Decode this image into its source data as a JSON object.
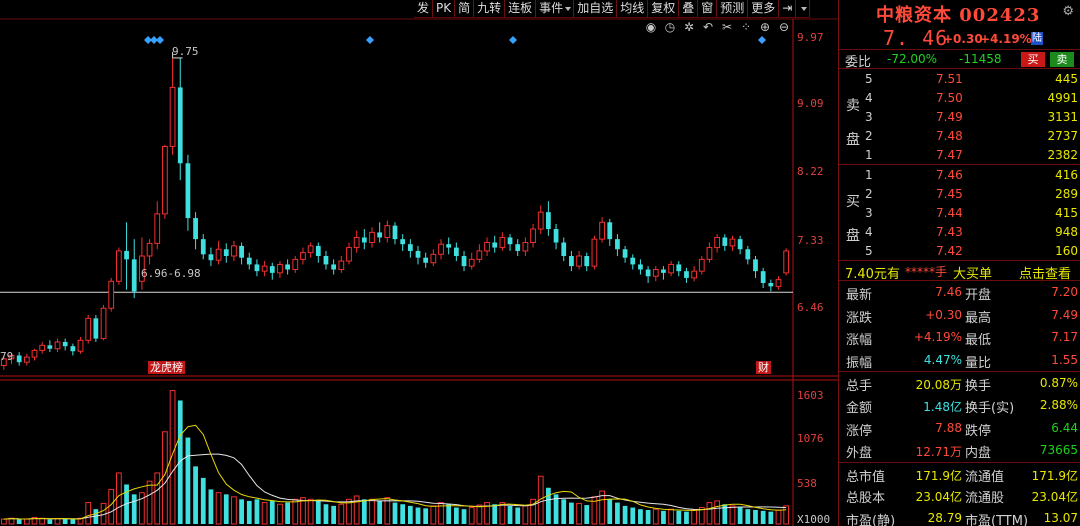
{
  "toolbar": {
    "items": [
      "发",
      "PK",
      "简",
      "九转",
      "连板",
      "事件",
      "加自选",
      "均线",
      "复权",
      "叠",
      "窗",
      "预测",
      "更多"
    ]
  },
  "icons": [
    "eye-icon",
    "clock-icon",
    "settings-icon",
    "undo-icon",
    "scissors-icon",
    "grid-icon",
    "zoom-in-icon",
    "zoom-out-icon"
  ],
  "chart_annotations": {
    "high_label": "9.75",
    "low_label": "6.96-6.98",
    "left_edge_label": "79",
    "event_tag_left": "龙虎榜",
    "event_tag_right": "财"
  },
  "chart_data": {
    "type": "candlestick",
    "price_axis_ticks": [
      "9.97",
      "9.09",
      "8.22",
      "7.33",
      "6.46"
    ],
    "volume_axis_ticks": [
      "1603",
      "1076",
      "538"
    ],
    "volume_unit_label": "X1000",
    "price_range": [
      6.0,
      10.2
    ],
    "reference_line": 6.97,
    "candles": [
      [
        6.1,
        6.18,
        6.05,
        6.2
      ],
      [
        6.18,
        6.22,
        6.12,
        6.25
      ],
      [
        6.22,
        6.14,
        6.1,
        6.26
      ],
      [
        6.14,
        6.2,
        6.1,
        6.24
      ],
      [
        6.2,
        6.28,
        6.16,
        6.3
      ],
      [
        6.28,
        6.34,
        6.24,
        6.38
      ],
      [
        6.34,
        6.3,
        6.26,
        6.4
      ],
      [
        6.3,
        6.38,
        6.26,
        6.42
      ],
      [
        6.38,
        6.33,
        6.28,
        6.42
      ],
      [
        6.33,
        6.27,
        6.22,
        6.36
      ],
      [
        6.27,
        6.4,
        6.24,
        6.44
      ],
      [
        6.4,
        6.66,
        6.36,
        6.7
      ],
      [
        6.66,
        6.42,
        6.38,
        6.7
      ],
      [
        6.42,
        6.78,
        6.4,
        6.82
      ],
      [
        6.78,
        7.1,
        6.74,
        7.14
      ],
      [
        7.1,
        7.46,
        7.06,
        7.5
      ],
      [
        7.46,
        7.36,
        7.0,
        7.8
      ],
      [
        7.36,
        6.98,
        6.9,
        7.6
      ],
      [
        7.1,
        7.4,
        7.0,
        7.62
      ],
      [
        7.4,
        7.55,
        7.3,
        7.6
      ],
      [
        7.55,
        7.9,
        7.48,
        8.05
      ],
      [
        7.9,
        8.7,
        7.84,
        8.72
      ],
      [
        8.7,
        9.4,
        8.6,
        9.75
      ],
      [
        9.4,
        8.5,
        8.3,
        9.75
      ],
      [
        8.5,
        7.85,
        7.7,
        8.6
      ],
      [
        7.85,
        7.6,
        7.48,
        7.92
      ],
      [
        7.6,
        7.42,
        7.36,
        7.66
      ],
      [
        7.42,
        7.35,
        7.28,
        7.5
      ],
      [
        7.35,
        7.48,
        7.3,
        7.58
      ],
      [
        7.48,
        7.4,
        7.32,
        7.55
      ],
      [
        7.4,
        7.52,
        7.34,
        7.58
      ],
      [
        7.52,
        7.38,
        7.3,
        7.56
      ],
      [
        7.38,
        7.3,
        7.24,
        7.44
      ],
      [
        7.3,
        7.22,
        7.16,
        7.36
      ],
      [
        7.22,
        7.28,
        7.16,
        7.34
      ],
      [
        7.28,
        7.2,
        7.12,
        7.32
      ],
      [
        7.2,
        7.3,
        7.14,
        7.34
      ],
      [
        7.3,
        7.24,
        7.18,
        7.36
      ],
      [
        7.24,
        7.36,
        7.2,
        7.4
      ],
      [
        7.36,
        7.44,
        7.3,
        7.5
      ],
      [
        7.44,
        7.52,
        7.38,
        7.56
      ],
      [
        7.52,
        7.4,
        7.32,
        7.56
      ],
      [
        7.4,
        7.3,
        7.24,
        7.46
      ],
      [
        7.3,
        7.24,
        7.18,
        7.36
      ],
      [
        7.24,
        7.34,
        7.2,
        7.4
      ],
      [
        7.34,
        7.5,
        7.3,
        7.56
      ],
      [
        7.5,
        7.62,
        7.44,
        7.7
      ],
      [
        7.62,
        7.56,
        7.48,
        7.72
      ],
      [
        7.56,
        7.68,
        7.5,
        7.74
      ],
      [
        7.68,
        7.62,
        7.56,
        7.8
      ],
      [
        7.62,
        7.76,
        7.56,
        7.82
      ],
      [
        7.76,
        7.6,
        7.54,
        7.8
      ],
      [
        7.6,
        7.54,
        7.46,
        7.66
      ],
      [
        7.54,
        7.46,
        7.38,
        7.6
      ],
      [
        7.46,
        7.38,
        7.3,
        7.52
      ],
      [
        7.38,
        7.32,
        7.26,
        7.44
      ],
      [
        7.32,
        7.42,
        7.28,
        7.48
      ],
      [
        7.42,
        7.54,
        7.36,
        7.6
      ],
      [
        7.54,
        7.5,
        7.42,
        7.62
      ],
      [
        7.5,
        7.4,
        7.34,
        7.56
      ],
      [
        7.4,
        7.28,
        7.22,
        7.46
      ],
      [
        7.28,
        7.36,
        7.24,
        7.44
      ],
      [
        7.36,
        7.46,
        7.32,
        7.54
      ],
      [
        7.46,
        7.56,
        7.4,
        7.62
      ],
      [
        7.56,
        7.5,
        7.44,
        7.64
      ],
      [
        7.5,
        7.62,
        7.46,
        7.68
      ],
      [
        7.62,
        7.54,
        7.46,
        7.66
      ],
      [
        7.54,
        7.46,
        7.4,
        7.6
      ],
      [
        7.46,
        7.56,
        7.4,
        7.62
      ],
      [
        7.56,
        7.72,
        7.5,
        7.78
      ],
      [
        7.72,
        7.92,
        7.66,
        8.0
      ],
      [
        7.92,
        7.72,
        7.64,
        8.05
      ],
      [
        7.72,
        7.56,
        7.48,
        7.78
      ],
      [
        7.56,
        7.4,
        7.34,
        7.62
      ],
      [
        7.4,
        7.28,
        7.22,
        7.46
      ],
      [
        7.28,
        7.4,
        7.24,
        7.46
      ],
      [
        7.4,
        7.28,
        7.22,
        7.44
      ],
      [
        7.28,
        7.6,
        7.24,
        7.64
      ],
      [
        7.6,
        7.8,
        7.56,
        7.86
      ],
      [
        7.8,
        7.6,
        7.52,
        7.84
      ],
      [
        7.6,
        7.48,
        7.4,
        7.66
      ],
      [
        7.48,
        7.38,
        7.32,
        7.52
      ],
      [
        7.38,
        7.3,
        7.24,
        7.42
      ],
      [
        7.3,
        7.24,
        7.18,
        7.36
      ],
      [
        7.24,
        7.16,
        7.08,
        7.28
      ],
      [
        7.16,
        7.24,
        7.1,
        7.28
      ],
      [
        7.24,
        7.2,
        7.12,
        7.28
      ],
      [
        7.2,
        7.3,
        7.16,
        7.34
      ],
      [
        7.3,
        7.22,
        7.16,
        7.34
      ],
      [
        7.22,
        7.14,
        7.08,
        7.26
      ],
      [
        7.14,
        7.22,
        7.1,
        7.28
      ],
      [
        7.22,
        7.36,
        7.18,
        7.4
      ],
      [
        7.36,
        7.5,
        7.32,
        7.56
      ],
      [
        7.5,
        7.62,
        7.44,
        7.66
      ],
      [
        7.62,
        7.52,
        7.46,
        7.66
      ],
      [
        7.52,
        7.6,
        7.46,
        7.64
      ],
      [
        7.6,
        7.48,
        7.42,
        7.64
      ],
      [
        7.48,
        7.36,
        7.3,
        7.52
      ],
      [
        7.36,
        7.22,
        7.14,
        7.4
      ],
      [
        7.22,
        7.08,
        7.02,
        7.26
      ],
      [
        7.08,
        7.04,
        6.98,
        7.12
      ],
      [
        7.04,
        7.12,
        7.0,
        7.16
      ],
      [
        7.2,
        7.46,
        7.17,
        7.49
      ]
    ],
    "volumes": [
      60,
      70,
      55,
      60,
      80,
      70,
      55,
      65,
      60,
      55,
      70,
      260,
      180,
      250,
      420,
      620,
      480,
      360,
      380,
      520,
      620,
      1120,
      1620,
      1500,
      1050,
      700,
      560,
      420,
      380,
      360,
      330,
      300,
      280,
      300,
      260,
      280,
      240,
      260,
      300,
      320,
      300,
      280,
      240,
      220,
      240,
      300,
      340,
      300,
      300,
      280,
      320,
      260,
      240,
      220,
      200,
      190,
      220,
      260,
      240,
      200,
      180,
      200,
      230,
      260,
      240,
      260,
      220,
      200,
      220,
      300,
      580,
      440,
      360,
      300,
      260,
      250,
      230,
      330,
      400,
      300,
      260,
      220,
      200,
      180,
      170,
      180,
      160,
      180,
      160,
      150,
      170,
      200,
      260,
      280,
      240,
      220,
      200,
      180,
      170,
      160,
      150,
      170,
      220
    ]
  },
  "quote": {
    "title": "中粮资本 002423",
    "last_price": "7. 46",
    "change": "+0.30",
    "change_pct": "+4.19%",
    "market_badge": "陆",
    "weibi_label": "委比",
    "weibi_pct": "-72.00%",
    "weibi_diff": "-11458",
    "buy_button": "买",
    "sell_button": "卖",
    "sell_side_label": [
      "卖",
      "盘"
    ],
    "buy_side_label": [
      "买",
      "盘"
    ],
    "asks": [
      {
        "level": "5",
        "price": "7.51",
        "qty": "445"
      },
      {
        "level": "4",
        "price": "7.50",
        "qty": "4991"
      },
      {
        "level": "3",
        "price": "7.49",
        "qty": "3131"
      },
      {
        "level": "2",
        "price": "7.48",
        "qty": "2737"
      },
      {
        "level": "1",
        "price": "7.47",
        "qty": "2382"
      }
    ],
    "bids": [
      {
        "level": "1",
        "price": "7.46",
        "qty": "416"
      },
      {
        "level": "2",
        "price": "7.45",
        "qty": "289"
      },
      {
        "level": "3",
        "price": "7.44",
        "qty": "415"
      },
      {
        "level": "4",
        "price": "7.43",
        "qty": "948"
      },
      {
        "level": "5",
        "price": "7.42",
        "qty": "160"
      }
    ],
    "big_buy": {
      "price": "7.40元有",
      "masked": "*****手",
      "text": "大买单",
      "link": "点击查看"
    },
    "stats": [
      {
        "l1": "最新",
        "v1": "7.46",
        "c1": "red",
        "l2": "开盘",
        "v2": "7.20",
        "c2": "red"
      },
      {
        "l1": "涨跌",
        "v1": "+0.30",
        "c1": "red",
        "l2": "最高",
        "v2": "7.49",
        "c2": "red"
      },
      {
        "l1": "涨幅",
        "v1": "+4.19%",
        "c1": "red",
        "l2": "最低",
        "v2": "7.17",
        "c2": "red"
      },
      {
        "l1": "振幅",
        "v1": "4.47%",
        "c1": "cyan",
        "l2": "量比",
        "v2": "1.55",
        "c2": "red"
      },
      {
        "l1": "总手",
        "v1": "20.08万",
        "c1": "yellow",
        "l2": "换手",
        "v2": "0.87%",
        "c2": "yellow"
      },
      {
        "l1": "金额",
        "v1": "1.48亿",
        "c1": "cyan",
        "l2": "换手(实)",
        "v2": "2.88%",
        "c2": "yellow"
      },
      {
        "l1": "涨停",
        "v1": "7.88",
        "c1": "red",
        "l2": "跌停",
        "v2": "6.44",
        "c2": "green"
      },
      {
        "l1": "外盘",
        "v1": "12.71万",
        "c1": "red",
        "l2": "内盘",
        "v2": "73665",
        "c2": "green"
      },
      {
        "l1": "总市值",
        "v1": "171.9亿",
        "c1": "yellow",
        "l2": "流通值",
        "v2": "171.9亿",
        "c2": "yellow"
      },
      {
        "l1": "总股本",
        "v1": "23.04亿",
        "c1": "yellow",
        "l2": "流通股",
        "v2": "23.04亿",
        "c2": "yellow"
      },
      {
        "l1": "市盈(静)",
        "v1": "28.79",
        "c1": "yellow",
        "l2": "市盈(TTM)",
        "v2": "13.07",
        "c2": "yellow"
      }
    ]
  },
  "colors": {
    "up": "#f03030",
    "down": "#40e0e0",
    "ma_white": "#e6e6e6",
    "ma_yellow": "#e8d800",
    "grid": "#6a0c0c"
  }
}
